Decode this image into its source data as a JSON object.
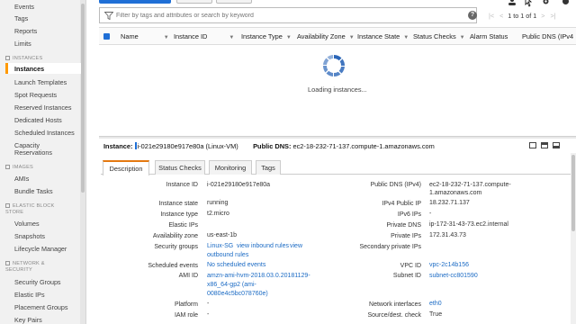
{
  "sidebar": {
    "top_items": [
      "Events",
      "Tags",
      "Reports",
      "Limits"
    ],
    "sections": [
      {
        "title": "INSTANCES",
        "items": [
          "Instances",
          "Launch Templates",
          "Spot Requests",
          "Reserved Instances",
          "Dedicated Hosts",
          "Scheduled Instances",
          "Capacity",
          "Reservations"
        ]
      },
      {
        "title": "IMAGES",
        "items": [
          "AMIs",
          "Bundle Tasks"
        ]
      },
      {
        "title_line1": "ELASTIC BLOCK",
        "title_line2": "STORE",
        "items": [
          "Volumes",
          "Snapshots",
          "Lifecycle Manager"
        ]
      },
      {
        "title_line1": "NETWORK &",
        "title_line2": "SECURITY",
        "items": [
          "Security Groups",
          "Elastic IPs",
          "Placement Groups",
          "Key Pairs"
        ]
      }
    ],
    "active_item": "Instances"
  },
  "search": {
    "placeholder": "Filter by tags and attributes or search by keyword",
    "help_label": "?"
  },
  "pager": {
    "text": "1 to 1 of 1"
  },
  "table": {
    "columns": [
      "Name",
      "Instance ID",
      "Instance Type",
      "Availability Zone",
      "Instance State",
      "Status Checks",
      "Alarm Status",
      "Public DNS (IPv4"
    ]
  },
  "loading_text": "Loading instances...",
  "detail_header": {
    "instance_label": "Instance:",
    "instance_id": "i-021e29180e917e80a (Linux-VM)",
    "dns_label": "Public DNS:",
    "dns_value": "ec2-18-232-71-137.compute-1.amazonaws.com"
  },
  "tabs": [
    "Description",
    "Status Checks",
    "Monitoring",
    "Tags"
  ],
  "active_tab": "Description",
  "details_left": [
    {
      "label": "Instance ID",
      "value": "i-021e29180e917e80a"
    },
    {
      "label": "Instance state",
      "value": "running"
    },
    {
      "label": "Instance type",
      "value": "t2.micro"
    },
    {
      "label": "Elastic IPs",
      "value": ""
    },
    {
      "label": "Availability zone",
      "value": "us-east-1b"
    },
    {
      "label": "Security groups",
      "value": "Linux-SG",
      "link1": "view inbound rules",
      "link2": "view",
      "link3": "outbound rules"
    },
    {
      "label": "Scheduled events",
      "value": "No scheduled events"
    },
    {
      "label": "AMI ID",
      "value_lines": [
        "amzn-ami-hvm-2018.03.0.20181129-",
        "x86_64-gp2 (ami-",
        "0080e4c5bc078760e)"
      ]
    },
    {
      "label": "Platform",
      "value": "-"
    },
    {
      "label": "IAM role",
      "value": "-"
    }
  ],
  "details_right": [
    {
      "label": "Public DNS (IPv4)",
      "value_lines": [
        "ec2-18-232-71-137.compute-",
        "1.amazonaws.com"
      ]
    },
    {
      "label": "IPv4 Public IP",
      "value": "18.232.71.137"
    },
    {
      "label": "IPv6 IPs",
      "value": "-"
    },
    {
      "label": "Private DNS",
      "value": "ip-172-31-43-73.ec2.internal"
    },
    {
      "label": "Private IPs",
      "value": "172.31.43.73"
    },
    {
      "label": "Secondary private IPs",
      "value": ""
    },
    {
      "label": "VPC ID",
      "value": "vpc-2c14b156"
    },
    {
      "label": "Subnet ID",
      "value": "subnet-cc801590"
    },
    {
      "label": "Network interfaces",
      "value": "eth0"
    },
    {
      "label": "Source/dest. check",
      "value": "True"
    }
  ],
  "colors": {
    "accent": "#e47911",
    "link": "#1a6ac4",
    "primary": "#1f6fd6"
  }
}
